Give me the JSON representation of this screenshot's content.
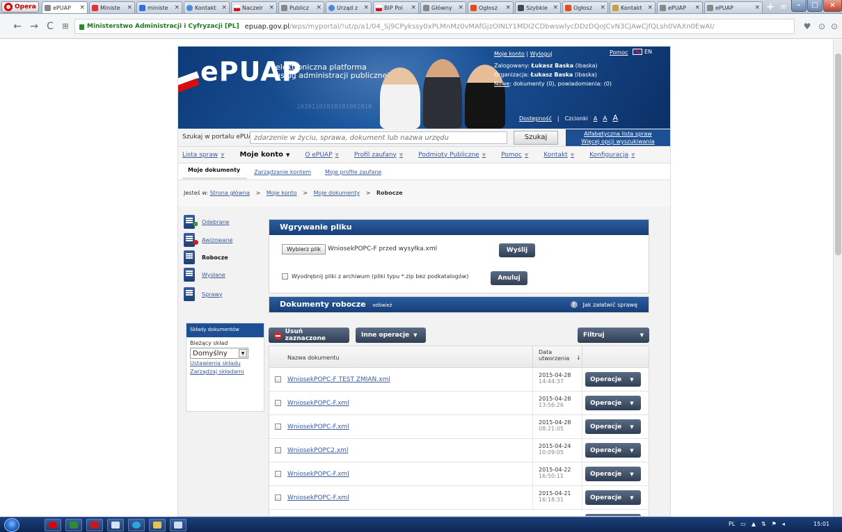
{
  "browser": {
    "opera_label": "Opera",
    "tabs": [
      {
        "label": "ePUAP",
        "icon": "page-icon",
        "active": true
      },
      {
        "label": "Ministe",
        "icon": "ministry-icon"
      },
      {
        "label": "ministe",
        "icon": "search-engine-icon"
      },
      {
        "label": "Kontakt",
        "icon": "globe-icon"
      },
      {
        "label": "Naczelr",
        "icon": "flag-icon"
      },
      {
        "label": "Publicz",
        "icon": "page-icon"
      },
      {
        "label": "Urząd z",
        "icon": "globe-icon"
      },
      {
        "label": "BIP Pol",
        "icon": "flag-icon"
      },
      {
        "label": "Główny",
        "icon": "page-icon"
      },
      {
        "label": "Ogłosz",
        "icon": "news-icon"
      },
      {
        "label": "Szybkie",
        "icon": "grid-icon"
      },
      {
        "label": "Ogłosz",
        "icon": "news-icon"
      },
      {
        "label": "Kontakt",
        "icon": "people-icon"
      },
      {
        "label": "ePUAP",
        "icon": "page-icon"
      },
      {
        "label": "ePUAP",
        "icon": "page-icon"
      }
    ],
    "tab_close": "×",
    "new_tab": "+",
    "url_cert": "Ministerstwo Administracji i Cyfryzacji [PL]",
    "url_host": "epuap.gov.pl",
    "url_path": "/wps/myportal/!ut/p/a1/04_Sj9CPykssy0xPLMnMz0vMAfGjzOINLY1MDI2CDbwswlycDDzDQoJCvN3CjAwCjfQLsh0VAXn0EwAI/"
  },
  "header": {
    "logo_text": "ePUAP",
    "logo_subtitle_1": "elektroniczna platforma",
    "logo_subtitle_2": "usług administracji publicznej",
    "binary_text": "10101101010101001010",
    "my_account": "Moje konto",
    "separator": "|",
    "logout": "Wyloguj",
    "help": "Pomoc",
    "lang": "EN",
    "logged_label": "Zalogowany:",
    "logged_user": "Łukasz Baska",
    "logged_login": "(lbaska)",
    "org_label": "Organizacja:",
    "org_user": "Łukasz Baska",
    "org_login": "(lbaska)",
    "new_label": "Nowe",
    "new_text": ": dokumenty (0), powiadomienia: (0)",
    "accessibility": "Dostępność",
    "fonts_label": "Czcionki",
    "font_sizes": [
      "A",
      "A",
      "A"
    ]
  },
  "search": {
    "label": "Szukaj w portalu ePUAP",
    "placeholder": "zdarzenie w życiu, sprawa, dokument lub nazwa urzędu",
    "button": "Szukaj",
    "link_alpha": "Alfabetyczna lista spraw",
    "link_more": "Więcej opcji wyszukiwania"
  },
  "nav": {
    "items": [
      {
        "label": "Lista spraw",
        "active": false
      },
      {
        "label": "Moje konto",
        "active": true
      },
      {
        "label": "O ePUAP",
        "active": false
      },
      {
        "label": "Profil zaufany",
        "active": false
      },
      {
        "label": "Podmioty Publiczne",
        "active": false
      },
      {
        "label": "Pomoc",
        "active": false
      },
      {
        "label": "Kontakt",
        "active": false
      },
      {
        "label": "Konfiguracja",
        "active": false
      }
    ],
    "dropdown_glyph": "▼"
  },
  "subnav": {
    "items": [
      "Moje dokumenty",
      "Zarządzanie kontem",
      "Moje profile zaufane"
    ]
  },
  "breadcrumb": {
    "prefix": "Jesteś w:",
    "items": [
      "Strona główna",
      "Moje konto",
      "Moje dokumenty"
    ],
    "current": "Robocze",
    "sep": ">"
  },
  "sidebar": {
    "items": [
      {
        "label": "Odebrane",
        "active": false
      },
      {
        "label": "Awizowane",
        "active": false
      },
      {
        "label": "Robocze",
        "active": true
      },
      {
        "label": "Wysłane",
        "active": false
      },
      {
        "label": "Sprawy",
        "active": false
      }
    ],
    "folders": {
      "title": "Składy dokumentów",
      "current_label": "Bieżący skład",
      "selected": "Domyślny",
      "link_settings": "Ustawienia składu",
      "link_manage": "Zarządzaj składami"
    }
  },
  "upload": {
    "title": "Wgrywanie pliku",
    "choose_button": "Wybierz plik",
    "file_name": "WniosekPOPC-F przed wysyłka.xml",
    "send_button": "Wyślij",
    "extract_label": "Wyodrębnij pliki z archiwum (pliki typu *.zip bez podkatalogów)",
    "cancel_button": "Anuluj"
  },
  "documents": {
    "title": "Dokumenty robocze",
    "refresh": "odśwież",
    "howto": "Jak załatwić sprawę",
    "delete_button": "Usuń zaznaczone",
    "other_ops_button": "Inne operacje",
    "filter_button": "Filtruj",
    "col_name": "Nazwa dokumentu",
    "col_date_1": "Data",
    "col_date_2": "utworzenia",
    "sort_glyph": "↓",
    "ops_label": "Operacje",
    "rows": [
      {
        "name": "WniosekPOPC-F TEST ZMIAN.xml",
        "date": "2015-04-28",
        "time": "14:44:37"
      },
      {
        "name": "WniosekPOPC-F.xml",
        "date": "2015-04-28",
        "time": "13:56:26"
      },
      {
        "name": "WniosekPOPC-F.xml",
        "date": "2015-04-28",
        "time": "08:21:05"
      },
      {
        "name": "WniosekPOPC2.xml",
        "date": "2015-04-24",
        "time": "10:09:05"
      },
      {
        "name": "WniosekPOPC-F.xml",
        "date": "2015-04-22",
        "time": "16:50:11"
      },
      {
        "name": "WniosekPOPC-F.xml",
        "date": "2015-04-21",
        "time": "16:18:31"
      }
    ]
  },
  "taskbar": {
    "lang": "PL",
    "clock": "15:01"
  }
}
